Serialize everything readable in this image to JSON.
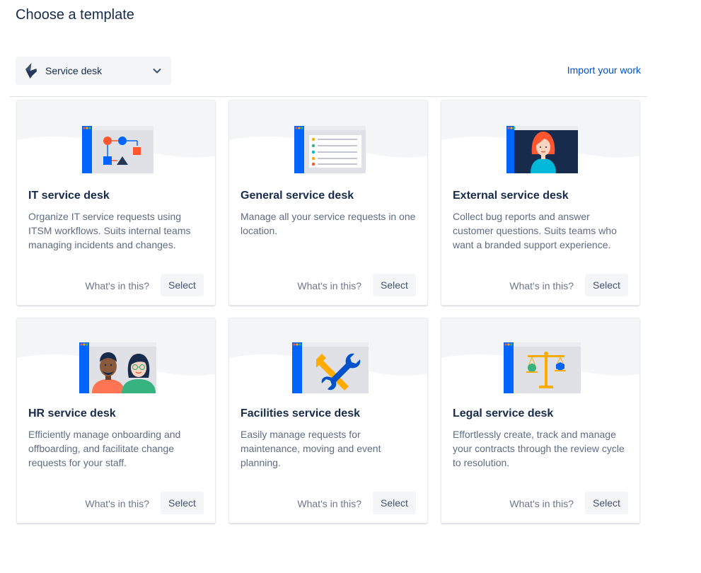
{
  "header": {
    "title": "Choose a template"
  },
  "filter": {
    "selected": "Service desk",
    "icon": "jira-service-desk-logo-icon"
  },
  "import_link": "Import your work",
  "colors": {
    "accent": "#0052cc",
    "text_dark": "#172b4d",
    "text_muted": "#5e6c84",
    "button_bg": "#f4f5f7"
  },
  "templates": [
    {
      "title": "IT service desk",
      "description": "Organize IT service requests using ITSM workflows. Suits internal teams managing incidents and changes.",
      "whats_label": "What's in this?",
      "select_label": "Select",
      "icon": "workflow-diagram-icon"
    },
    {
      "title": "General service desk",
      "description": "Manage all your service requests in one location.",
      "whats_label": "What's in this?",
      "select_label": "Select",
      "icon": "request-list-icon"
    },
    {
      "title": "External service desk",
      "description": "Collect bug reports and answer customer questions. Suits teams who want a branded support experience.",
      "whats_label": "What's in this?",
      "select_label": "Select",
      "icon": "support-agent-icon"
    },
    {
      "title": "HR service desk",
      "description": "Efficiently manage onboarding and offboarding, and facilitate change requests for your staff.",
      "whats_label": "What's in this?",
      "select_label": "Select",
      "icon": "people-icon"
    },
    {
      "title": "Facilities service desk",
      "description": "Easily manage requests for maintenance, moving and event planning.",
      "whats_label": "What's in this?",
      "select_label": "Select",
      "icon": "tools-icon"
    },
    {
      "title": "Legal service desk",
      "description": "Effortlessly create, track and manage your contracts through the review cycle to resolution.",
      "whats_label": "What's in this?",
      "select_label": "Select",
      "icon": "scales-icon"
    }
  ]
}
